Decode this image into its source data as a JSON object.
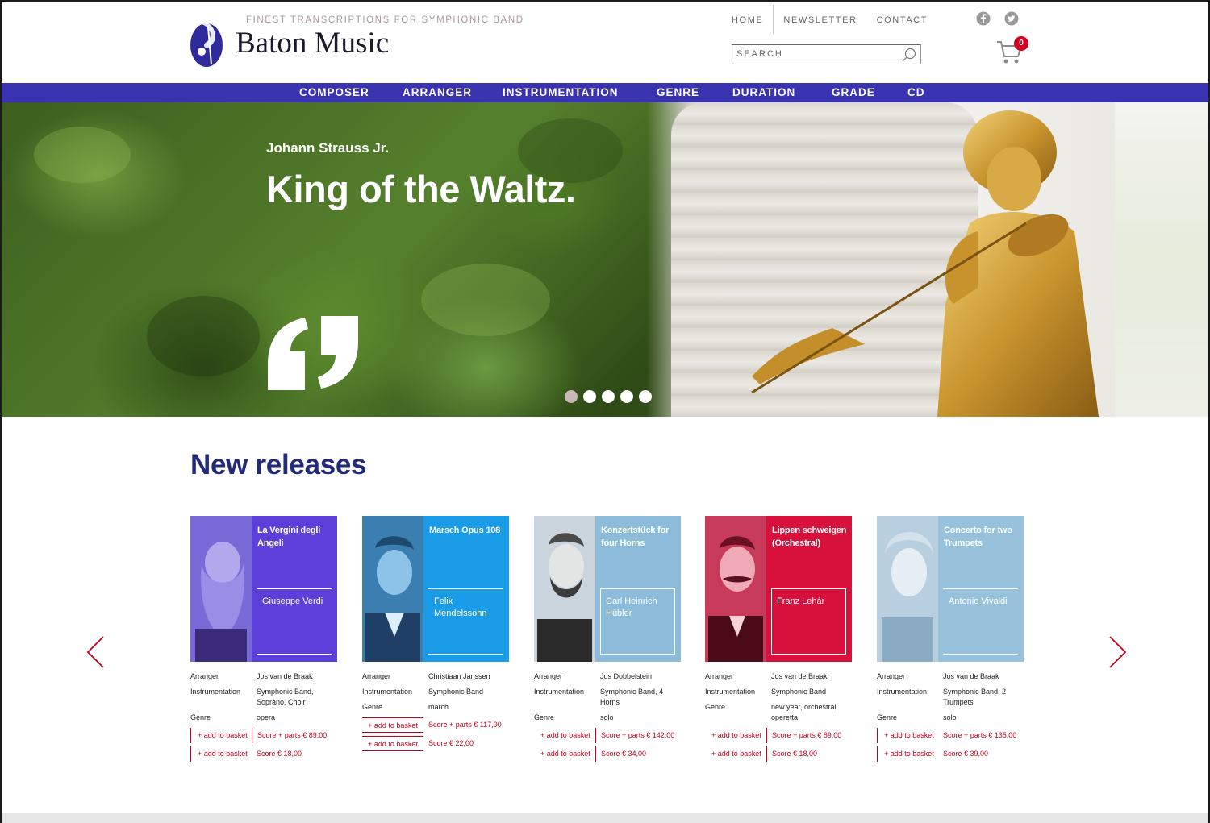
{
  "header": {
    "tagline": "FINEST TRANSCRIPTIONS FOR SYMPHONIC BAND",
    "brand": "Baton Music",
    "nav": [
      "HOME",
      "NEWSLETTER",
      "CONTACT"
    ],
    "search_placeholder": "SEARCH",
    "cart_count": "0"
  },
  "categories": [
    "COMPOSER",
    "ARRANGER",
    "INSTRUMENTATION",
    "GENRE",
    "DURATION",
    "GRADE",
    "CD"
  ],
  "hero": {
    "subtitle": "Johann Strauss Jr.",
    "title": "King of the Waltz.",
    "active_slide": 1,
    "slide_count": 5
  },
  "section_title": "New releases",
  "releases": [
    {
      "title": "La Vergini degli Angeli",
      "composer": "Giuseppe Verdi",
      "color": "#5a3fd8",
      "fields": [
        {
          "label": "Arranger",
          "value": "Jos van de Braak"
        },
        {
          "label": "Instrumentation",
          "value": "Symphonic Band, Soprano, Choir"
        },
        {
          "label": "Genre",
          "value": "opera"
        }
      ],
      "add_label": "+ add to basket",
      "prices": [
        "Score + parts € 89,00",
        "Score € 18,00"
      ]
    },
    {
      "title": "Marsch Opus 108",
      "composer": "Felix Mendelssohn",
      "color": "#1a9be8",
      "fields": [
        {
          "label": "Arranger",
          "value": "Christiaan Janssen"
        },
        {
          "label": "Instrumentation",
          "value": "Symphonic Band"
        },
        {
          "label": "Genre",
          "value": "march"
        }
      ],
      "add_label": "+ add to basket",
      "prices": [
        "Score + parts € 117,00",
        "Score € 22,00"
      ]
    },
    {
      "title": "Konzertstück for four Horns",
      "composer": "Carl Heinrich Hübler",
      "color": "#8cbcd9",
      "fields": [
        {
          "label": "Arranger",
          "value": "Jos Dobbelstein"
        },
        {
          "label": "Instrumentation",
          "value": "Symphonic Band, 4 Horns"
        },
        {
          "label": "Genre",
          "value": "solo"
        }
      ],
      "add_label": "+ add to basket",
      "prices": [
        "Score + parts € 142,00",
        "Score € 34,00"
      ]
    },
    {
      "title": "Lippen schweigen (Orchestral)",
      "composer": "Franz Lehár",
      "color": "#d8103c",
      "fields": [
        {
          "label": "Arranger",
          "value": "Jos van de Braak"
        },
        {
          "label": "Instrumentation",
          "value": "Symphonic Band"
        },
        {
          "label": "Genre",
          "value": "new year, orchestral, operetta"
        }
      ],
      "add_label": "+ add to basket",
      "prices": [
        "Score + parts € 89,00",
        "Score € 18,00"
      ]
    },
    {
      "title": "Concerto for two Trumpets",
      "composer": "Antonio Vivaldi",
      "color": "#98c2dc",
      "fields": [
        {
          "label": "Arranger",
          "value": "Jos van de Braak"
        },
        {
          "label": "Instrumentation",
          "value": "Symphonic Band, 2 Trumpets"
        },
        {
          "label": "Genre",
          "value": "solo"
        }
      ],
      "add_label": "+ add to basket",
      "prices": [
        "Score + parts € 135,00",
        "Score € 39,00"
      ]
    }
  ],
  "icons": {
    "facebook": "facebook-icon",
    "twitter": "twitter-icon",
    "search": "search-icon",
    "cart": "cart-icon",
    "prev": "chevron-left-icon",
    "next": "chevron-right-icon",
    "quote": "quote-icon"
  },
  "colors": {
    "accent": "#3a33b0",
    "heading": "#232a78",
    "price_red": "#c4001d",
    "badge": "#d4001f"
  }
}
